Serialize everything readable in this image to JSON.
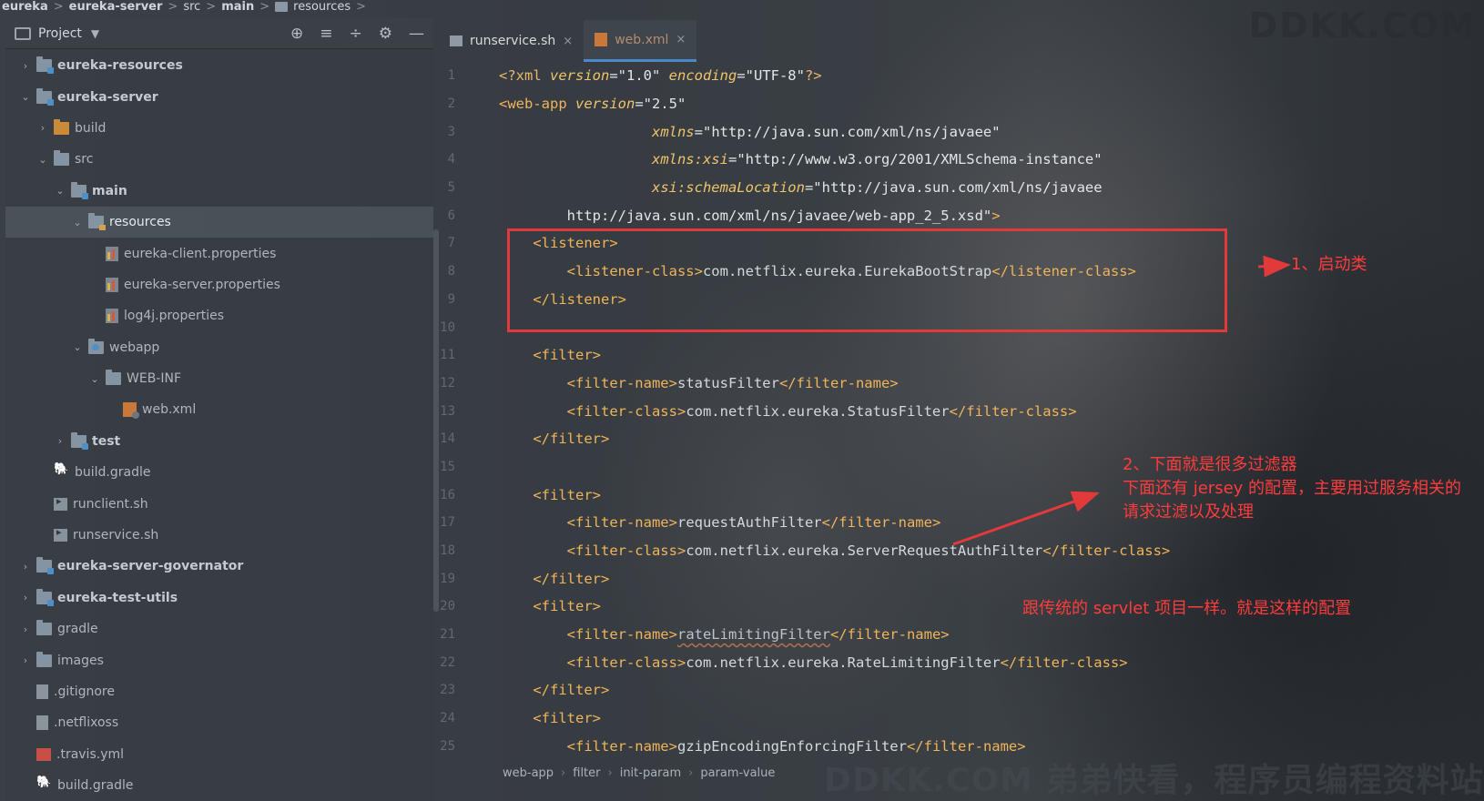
{
  "breadcrumb": [
    {
      "label": "eureka",
      "bold": true
    },
    {
      "label": "eureka-server",
      "bold": true
    },
    {
      "label": "src",
      "bold": false
    },
    {
      "label": "main",
      "bold": true
    },
    {
      "label": "resources",
      "bold": false
    }
  ],
  "project_panel": {
    "title": "Project",
    "dropdown": "▼",
    "tools": [
      "⊕",
      "≡",
      "÷",
      "⚙",
      "—"
    ],
    "tree": [
      {
        "label": "eureka-resources",
        "depth": 1,
        "chevron": "›",
        "icon": "module-folder",
        "bold": true
      },
      {
        "label": "eureka-server",
        "depth": 1,
        "chevron": "⌄",
        "icon": "module-folder",
        "bold": true
      },
      {
        "label": "build",
        "depth": 2,
        "chevron": "›",
        "icon": "orange-folder",
        "bold": false
      },
      {
        "label": "src",
        "depth": 2,
        "chevron": "⌄",
        "icon": "folder",
        "bold": false
      },
      {
        "label": "main",
        "depth": 3,
        "chevron": "⌄",
        "icon": "module-folder",
        "bold": true
      },
      {
        "label": "resources",
        "depth": 4,
        "chevron": "⌄",
        "icon": "resources-folder",
        "bold": false,
        "selected": true
      },
      {
        "label": "eureka-client.properties",
        "depth": 5,
        "chevron": "",
        "icon": "properties-file",
        "bold": false
      },
      {
        "label": "eureka-server.properties",
        "depth": 5,
        "chevron": "",
        "icon": "properties-file",
        "bold": false
      },
      {
        "label": "log4j.properties",
        "depth": 5,
        "chevron": "",
        "icon": "properties-file",
        "bold": false
      },
      {
        "label": "webapp",
        "depth": 4,
        "chevron": "⌄",
        "icon": "web-folder",
        "bold": false
      },
      {
        "label": "WEB-INF",
        "depth": 5,
        "chevron": "⌄",
        "icon": "folder",
        "bold": false
      },
      {
        "label": "web.xml",
        "depth": 6,
        "chevron": "",
        "icon": "xml-file",
        "bold": false
      },
      {
        "label": "test",
        "depth": 3,
        "chevron": "›",
        "icon": "module-folder",
        "bold": true
      },
      {
        "label": "build.gradle",
        "depth": 2,
        "chevron": "",
        "icon": "gradle-file",
        "bold": false
      },
      {
        "label": "runclient.sh",
        "depth": 2,
        "chevron": "",
        "icon": "shell-file",
        "bold": false
      },
      {
        "label": "runservice.sh",
        "depth": 2,
        "chevron": "",
        "icon": "shell-file",
        "bold": false
      },
      {
        "label": "eureka-server-governator",
        "depth": 1,
        "chevron": "›",
        "icon": "module-folder",
        "bold": true
      },
      {
        "label": "eureka-test-utils",
        "depth": 1,
        "chevron": "›",
        "icon": "module-folder",
        "bold": true
      },
      {
        "label": "gradle",
        "depth": 1,
        "chevron": "›",
        "icon": "folder",
        "bold": false
      },
      {
        "label": "images",
        "depth": 1,
        "chevron": "›",
        "icon": "folder",
        "bold": false
      },
      {
        "label": ".gitignore",
        "depth": 1,
        "chevron": "",
        "icon": "text-file",
        "bold": false
      },
      {
        "label": ".netflixoss",
        "depth": 1,
        "chevron": "",
        "icon": "text-file",
        "bold": false
      },
      {
        "label": ".travis.yml",
        "depth": 1,
        "chevron": "",
        "icon": "yml-file",
        "bold": false
      },
      {
        "label": "build.gradle",
        "depth": 1,
        "chevron": "",
        "icon": "gradle-file",
        "bold": false
      }
    ]
  },
  "tabs": [
    {
      "label": "runservice.sh",
      "active": false,
      "close": "×"
    },
    {
      "label": "web.xml",
      "active": true,
      "close": "×"
    }
  ],
  "code_lines": [
    {
      "n": "1",
      "indent": 0,
      "tokens": [
        [
          "tag",
          "<?xml "
        ],
        [
          "attr",
          "version"
        ],
        [
          "str",
          "=\"1.0\" "
        ],
        [
          "attr",
          "encoding"
        ],
        [
          "str",
          "=\"UTF-8\""
        ],
        [
          "tag",
          "?>"
        ]
      ]
    },
    {
      "n": "2",
      "indent": 0,
      "tokens": [
        [
          "ptag",
          "<web-app "
        ],
        [
          "attr",
          "version"
        ],
        [
          "str",
          "=\"2.5\""
        ]
      ]
    },
    {
      "n": "3",
      "indent": 9,
      "tokens": [
        [
          "attr",
          "xmlns"
        ],
        [
          "str",
          "=\"http://java.sun.com/xml/ns/javaee\""
        ]
      ]
    },
    {
      "n": "4",
      "indent": 9,
      "tokens": [
        [
          "attr",
          "xmlns:xsi"
        ],
        [
          "str",
          "=\"http://www.w3.org/2001/XMLSchema-instance\""
        ]
      ]
    },
    {
      "n": "5",
      "indent": 9,
      "tokens": [
        [
          "attr",
          "xsi:schemaLocation"
        ],
        [
          "str",
          "=\"http://java.sun.com/xml/ns/javaee"
        ]
      ]
    },
    {
      "n": "6",
      "indent": 4,
      "tokens": [
        [
          "str",
          "http://java.sun.com/xml/ns/javaee/web-app_2_5.xsd\""
        ],
        [
          "ptag",
          ">"
        ]
      ]
    },
    {
      "n": "7",
      "indent": 2,
      "tokens": [
        [
          "ptag",
          "<listener>"
        ]
      ]
    },
    {
      "n": "8",
      "indent": 4,
      "tokens": [
        [
          "ptag",
          "<listener-class>"
        ],
        [
          "txt",
          "com.netflix.eureka.EurekaBootStrap"
        ],
        [
          "ptag",
          "</listener-class>"
        ]
      ]
    },
    {
      "n": "9",
      "indent": 2,
      "tokens": [
        [
          "ptag",
          "</listener>"
        ]
      ]
    },
    {
      "n": "10",
      "indent": 0,
      "tokens": []
    },
    {
      "n": "11",
      "indent": 2,
      "tokens": [
        [
          "ptag",
          "<filter>"
        ]
      ]
    },
    {
      "n": "12",
      "indent": 4,
      "tokens": [
        [
          "ptag",
          "<filter-name>"
        ],
        [
          "txt",
          "statusFilter"
        ],
        [
          "ptag",
          "</filter-name>"
        ]
      ]
    },
    {
      "n": "13",
      "indent": 4,
      "tokens": [
        [
          "ptag",
          "<filter-class>"
        ],
        [
          "txt",
          "com.netflix.eureka.StatusFilter"
        ],
        [
          "ptag",
          "</filter-class>"
        ]
      ]
    },
    {
      "n": "14",
      "indent": 2,
      "tokens": [
        [
          "ptag",
          "</filter>"
        ]
      ]
    },
    {
      "n": "15",
      "indent": 0,
      "tokens": []
    },
    {
      "n": "16",
      "indent": 2,
      "tokens": [
        [
          "ptag",
          "<filter>"
        ]
      ]
    },
    {
      "n": "17",
      "indent": 4,
      "tokens": [
        [
          "ptag",
          "<filter-name>"
        ],
        [
          "txt",
          "requestAuthFilter"
        ],
        [
          "ptag",
          "</filter-name>"
        ]
      ]
    },
    {
      "n": "18",
      "indent": 4,
      "tokens": [
        [
          "ptag",
          "<filter-class>"
        ],
        [
          "txt",
          "com.netflix.eureka.ServerRequestAuthFilter"
        ],
        [
          "ptag",
          "</filter-class>"
        ]
      ]
    },
    {
      "n": "19",
      "indent": 2,
      "tokens": [
        [
          "ptag",
          "</filter>"
        ]
      ]
    },
    {
      "n": "20",
      "indent": 2,
      "tokens": [
        [
          "ptag",
          "<filter>"
        ]
      ]
    },
    {
      "n": "21",
      "indent": 4,
      "tokens": [
        [
          "ptag",
          "<filter-name>"
        ],
        [
          "wavy",
          "rateLimitingFilter"
        ],
        [
          "ptag",
          "</filter-name>"
        ]
      ]
    },
    {
      "n": "22",
      "indent": 4,
      "tokens": [
        [
          "ptag",
          "<filter-class>"
        ],
        [
          "txt",
          "com.netflix.eureka.RateLimitingFilter"
        ],
        [
          "ptag",
          "</filter-class>"
        ]
      ]
    },
    {
      "n": "23",
      "indent": 2,
      "tokens": [
        [
          "ptag",
          "</filter>"
        ]
      ]
    },
    {
      "n": "24",
      "indent": 2,
      "tokens": [
        [
          "ptag",
          "<filter>"
        ]
      ]
    },
    {
      "n": "25",
      "indent": 4,
      "tokens": [
        [
          "ptag",
          "<filter-name>"
        ],
        [
          "txt",
          "gzipEncodingEnforcingFilter"
        ],
        [
          "ptag",
          "</filter-name>"
        ]
      ]
    }
  ],
  "statusbar": [
    "web-app",
    "filter",
    "init-param",
    "param-value"
  ],
  "annotations": {
    "first": "1、启动类",
    "second_1": "2、下面就是很多过滤器",
    "second_2": "下面还有 jersey 的配置，主要用过服务相关的",
    "second_3": "请求过滤以及处理",
    "third": "跟传统的 servlet 项目一样。就是这样的配置",
    "color": "#ff3b3b"
  },
  "watermarks": {
    "top": "DDKK.COM",
    "bottom": "DDKK.COM 弟弟快看，程序员编程资料站"
  }
}
